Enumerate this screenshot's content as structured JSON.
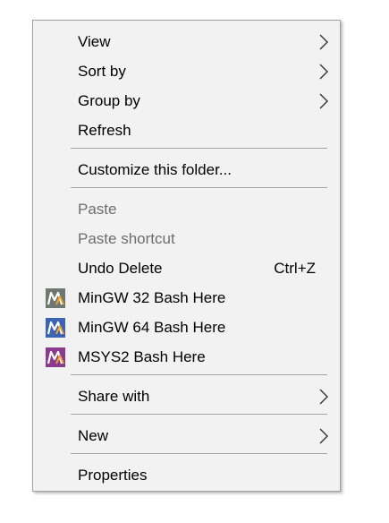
{
  "menu": {
    "view": "View",
    "sort_by": "Sort by",
    "group_by": "Group by",
    "refresh": "Refresh",
    "customize": "Customize this folder...",
    "paste": "Paste",
    "paste_shortcut": "Paste shortcut",
    "undo_delete": "Undo Delete",
    "undo_shortcut": "Ctrl+Z",
    "mingw32": "MinGW 32 Bash Here",
    "mingw64": "MinGW 64 Bash Here",
    "msys2": "MSYS2 Bash Here",
    "share_with": "Share with",
    "new": "New",
    "properties": "Properties"
  },
  "icons": {
    "submenu_arrow": "chevron-right-icon",
    "mingw32": "mingw32-icon",
    "mingw64": "mingw64-icon",
    "msys2": "msys2-icon"
  },
  "colors": {
    "menu_background": "#f2f2f2",
    "disabled_text": "#6d6d6d",
    "mingw32_icon": "#6f7773",
    "mingw64_icon": "#3b64b5",
    "msys2_icon": "#8a3a8f",
    "icon_accent": "#f2a12e"
  }
}
